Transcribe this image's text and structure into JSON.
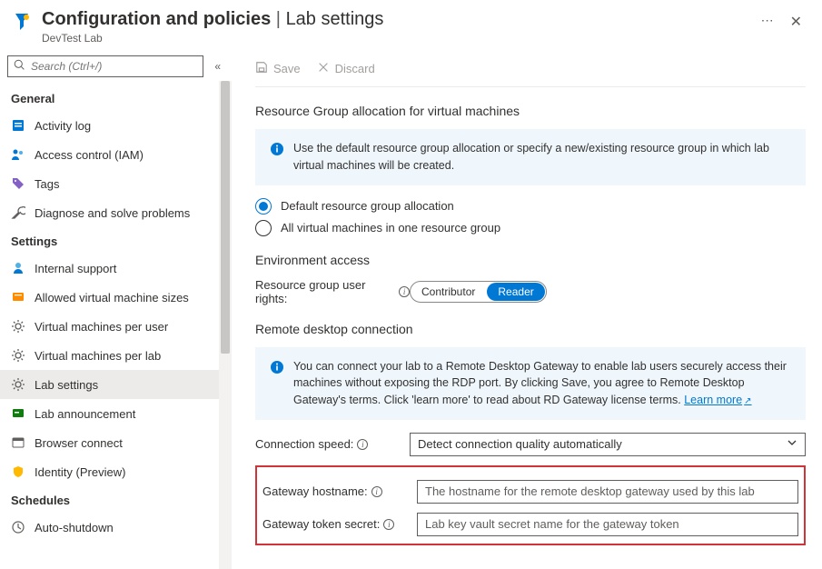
{
  "header": {
    "title_main": "Configuration and policies",
    "title_sep": "|",
    "title_sub": "Lab settings",
    "subtitle": "DevTest Lab",
    "ellipsis": "⋯",
    "close": "✕"
  },
  "search": {
    "placeholder": "Search (Ctrl+/)",
    "collapse": "«"
  },
  "nav": {
    "group_general": "General",
    "activity_log": "Activity log",
    "access_control": "Access control (IAM)",
    "tags": "Tags",
    "diagnose": "Diagnose and solve problems",
    "group_settings": "Settings",
    "internal_support": "Internal support",
    "allowed_vm_sizes": "Allowed virtual machine sizes",
    "vms_per_user": "Virtual machines per user",
    "vms_per_lab": "Virtual machines per lab",
    "lab_settings": "Lab settings",
    "lab_announcement": "Lab announcement",
    "browser_connect": "Browser connect",
    "identity_preview": "Identity (Preview)",
    "group_schedules": "Schedules",
    "auto_shutdown": "Auto-shutdown"
  },
  "commands": {
    "save": "Save",
    "discard": "Discard"
  },
  "section1": {
    "title": "Resource Group allocation for virtual machines",
    "info": "Use the default resource group allocation or specify a new/existing resource group in which lab virtual machines will be created.",
    "radio1": "Default resource group allocation",
    "radio2": "All virtual machines in one resource group"
  },
  "section2": {
    "title": "Environment access",
    "label": "Resource group user rights:",
    "option_contributor": "Contributor",
    "option_reader": "Reader"
  },
  "section3": {
    "title": "Remote desktop connection",
    "info_pre": "You can connect your lab to a Remote Desktop Gateway to enable lab users securely access their machines without exposing the RDP port. By clicking Save, you agree to Remote Desktop Gateway's terms.  Click 'learn more' to read about RD Gateway license terms. ",
    "learn_more": "Learn more",
    "conn_speed_label": "Connection speed:",
    "conn_speed_value": "Detect connection quality automatically",
    "gw_hostname_label": "Gateway hostname:",
    "gw_hostname_placeholder": "The hostname for the remote desktop gateway used by this lab",
    "gw_token_label": "Gateway token secret:",
    "gw_token_placeholder": "Lab key vault secret name for the gateway token"
  }
}
